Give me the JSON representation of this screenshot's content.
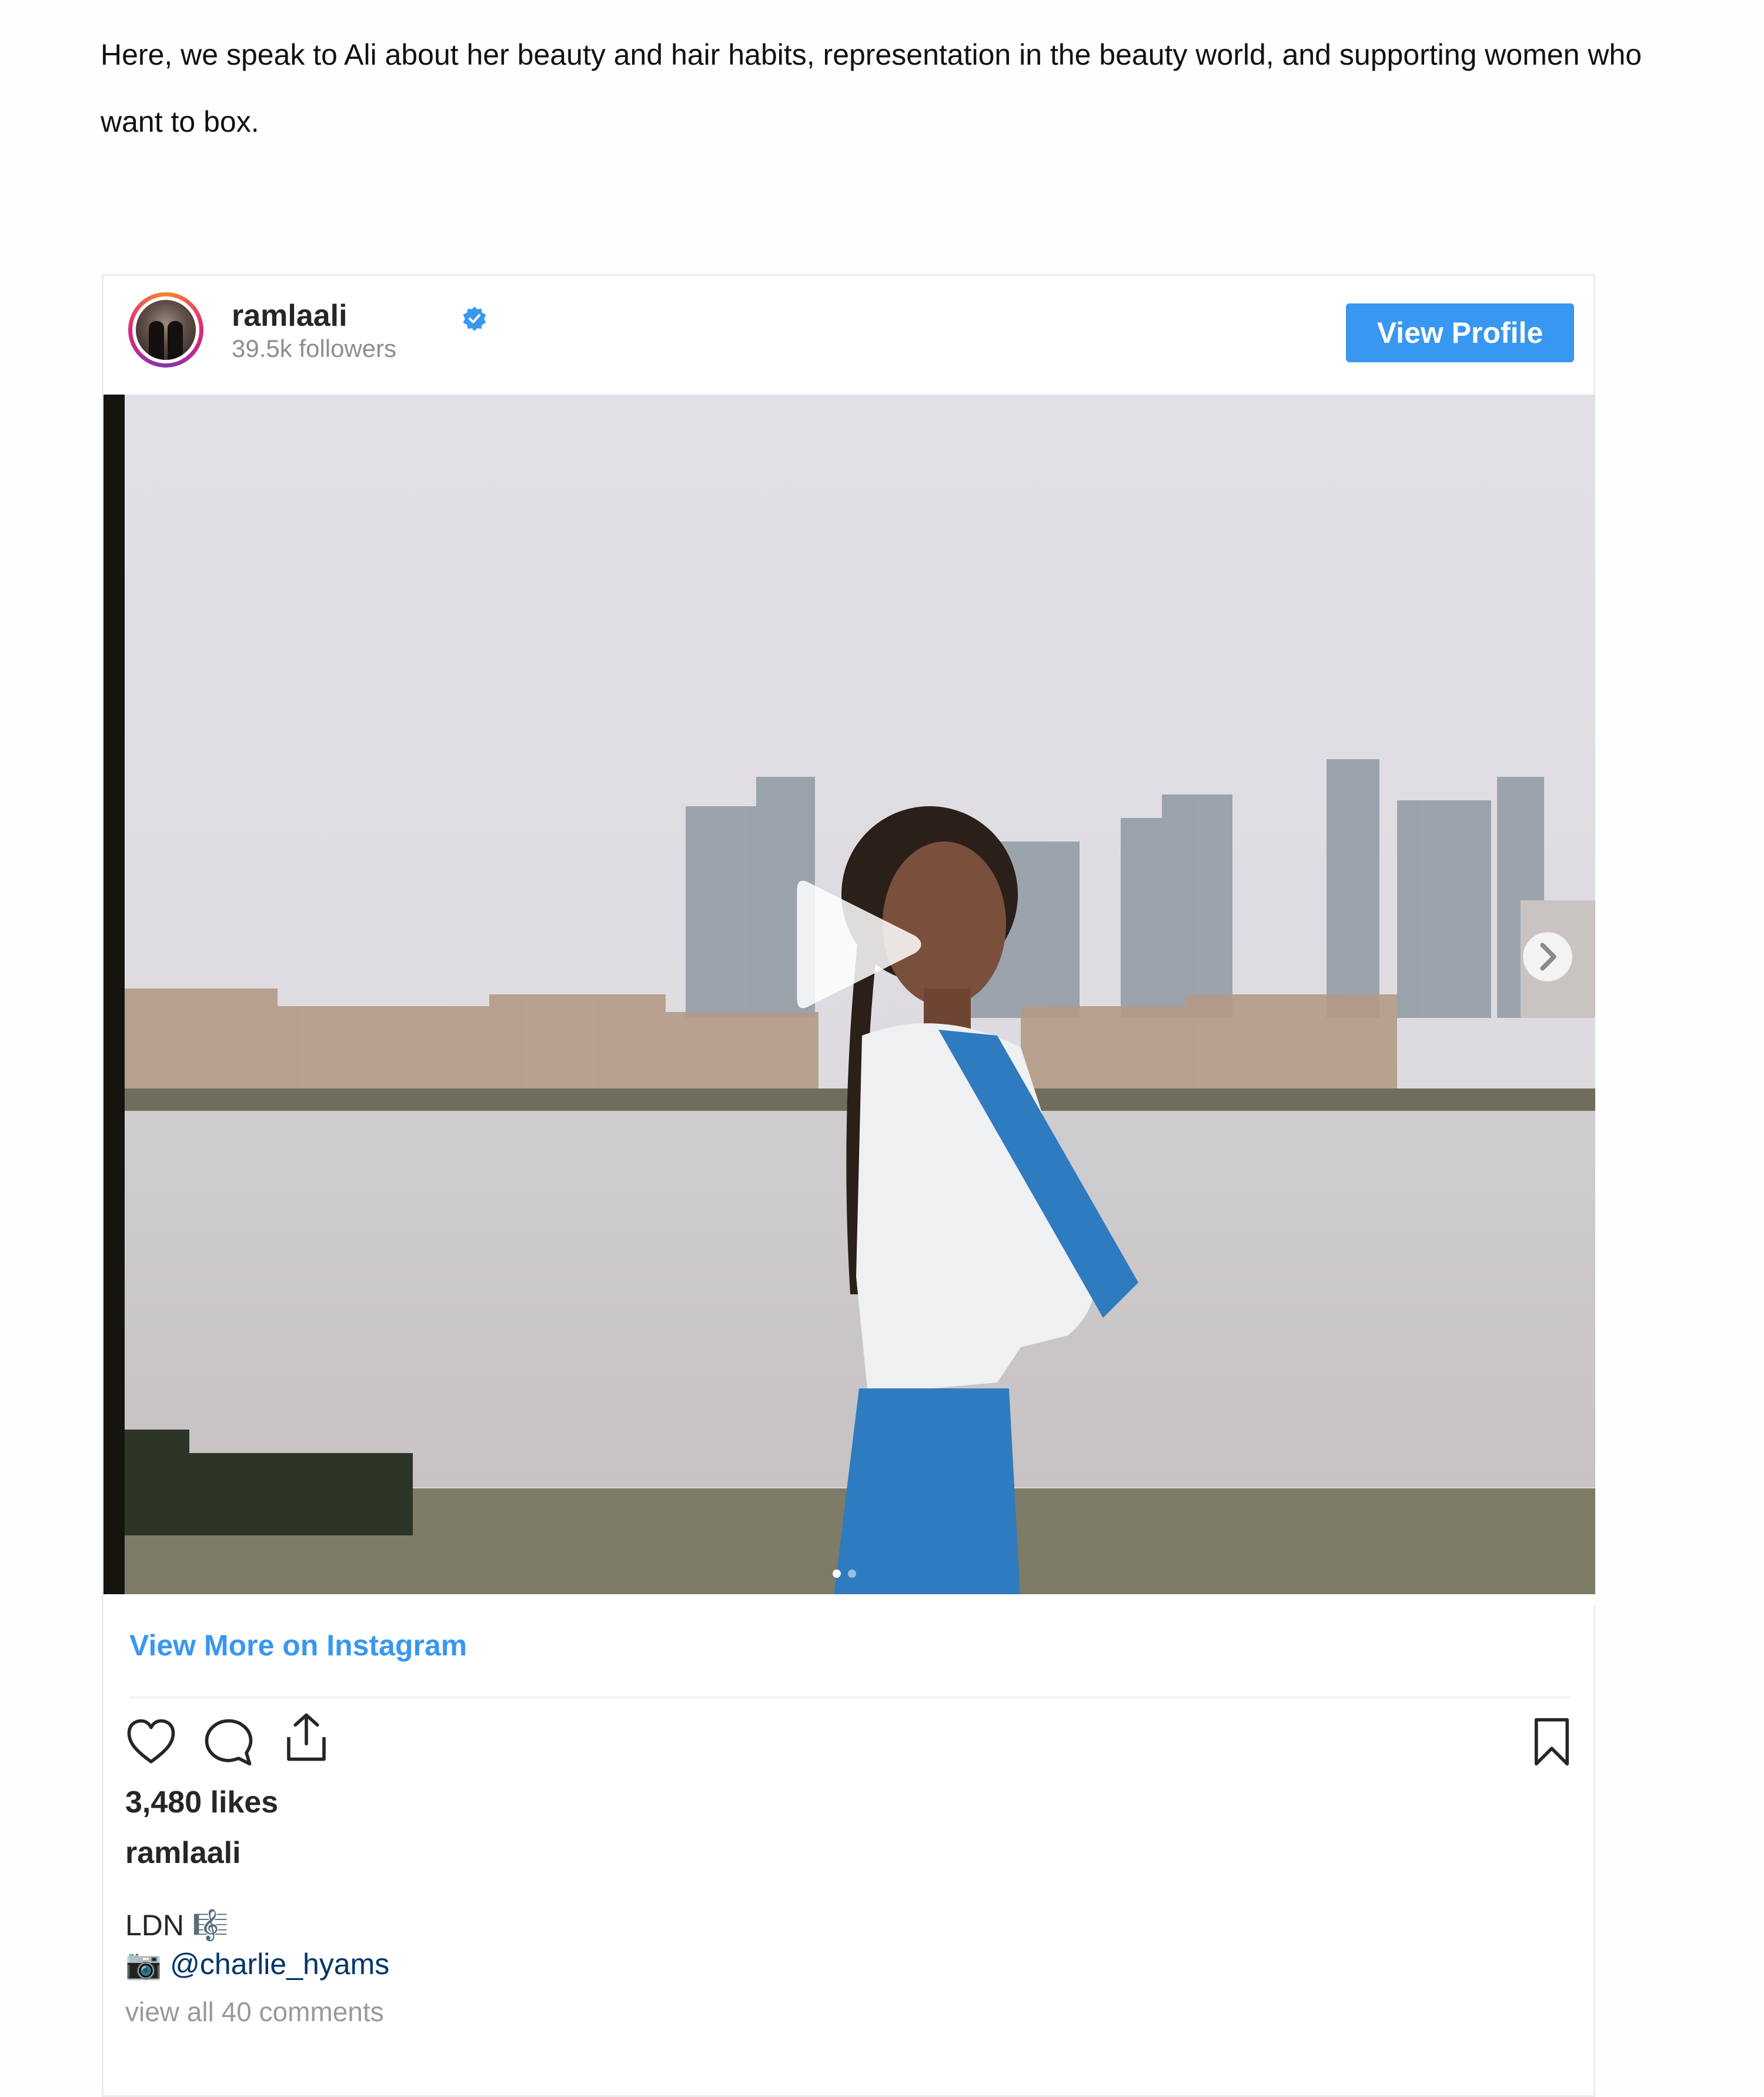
{
  "article": {
    "intro": "Here, we speak to Ali about her beauty and hair habits, representation in the beauty world, and supporting women who want to box."
  },
  "embed": {
    "username": "ramlaali",
    "followers": "39.5k followers",
    "view_profile_label": "View Profile",
    "view_more_label": "View More on Instagram",
    "likes": "3,480 likes",
    "caption_user": "ramlaali",
    "caption_line1": "LDN 🎼",
    "camera_emoji": "📷",
    "mention": "@charlie_hyams",
    "view_comments": "view all 40 comments",
    "carousel": {
      "total_slides": 2,
      "current_slide": 1
    },
    "icons": {
      "verified": "verified-badge-icon",
      "play": "play-icon",
      "next": "chevron-right-icon",
      "like": "heart-icon",
      "comment": "comment-bubble-icon",
      "share": "share-icon",
      "bookmark": "bookmark-icon"
    },
    "colors": {
      "accent": "#3897f0",
      "text": "#262626",
      "muted": "#8e8e8e",
      "mention": "#003569"
    }
  }
}
